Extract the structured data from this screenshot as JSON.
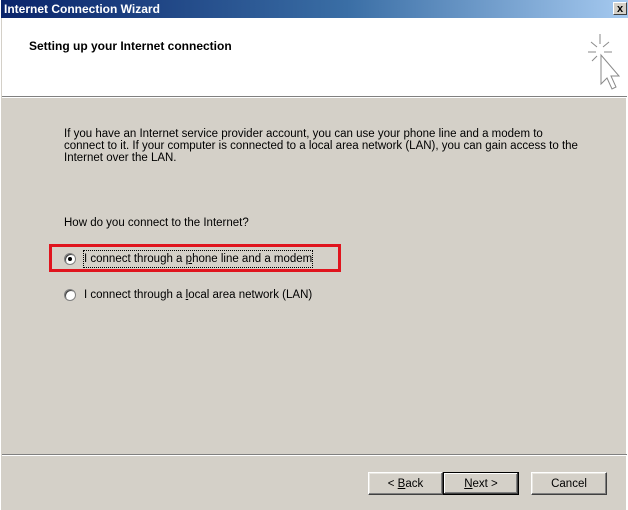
{
  "window": {
    "title": "Internet Connection Wizard",
    "close_glyph": "x"
  },
  "header": {
    "title": "Setting up your Internet connection",
    "icon": "sparkle-cursor-icon"
  },
  "body": {
    "intro": "If you have an Internet service provider account, you can use your phone line and a modem to connect to it. If your computer is connected to a local area network (LAN), you can gain access to the Internet over the LAN.",
    "question": "How do you connect to the Internet?",
    "options": [
      {
        "pre": "I connect through a ",
        "accel": "p",
        "post": "hone line and a modem",
        "checked": true
      },
      {
        "pre": "I connect through a ",
        "accel": "l",
        "post": "ocal area network (LAN)",
        "checked": false
      }
    ]
  },
  "buttons": {
    "back": {
      "pre": "< ",
      "accel": "B",
      "post": "ack"
    },
    "next": {
      "pre": "",
      "accel": "N",
      "post": "ext >"
    },
    "cancel": "Cancel"
  },
  "colors": {
    "highlight": "#e0141e",
    "titlebar_start": "#0a246a",
    "titlebar_end": "#a6caf0"
  }
}
